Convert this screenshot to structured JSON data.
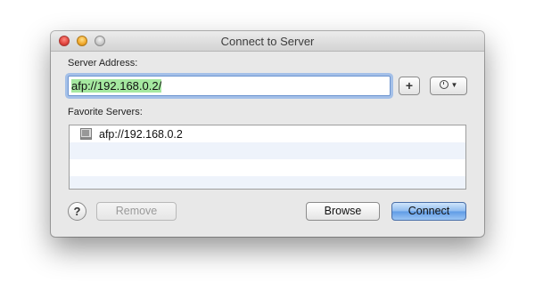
{
  "window": {
    "title": "Connect to Server"
  },
  "server_address": {
    "label": "Server Address:",
    "value": "afp://192.168.0.2/"
  },
  "buttons": {
    "add": "+",
    "history_icon": "clock-icon",
    "remove": "Remove",
    "browse": "Browse",
    "connect": "Connect",
    "help": "?"
  },
  "favorites": {
    "label": "Favorite Servers:",
    "items": [
      {
        "label": "afp://192.168.0.2",
        "icon": "server-icon"
      }
    ]
  },
  "colors": {
    "accent": "#6c9ee8",
    "selection": "#a5e8a0",
    "connect_button": "#5f9be6"
  }
}
